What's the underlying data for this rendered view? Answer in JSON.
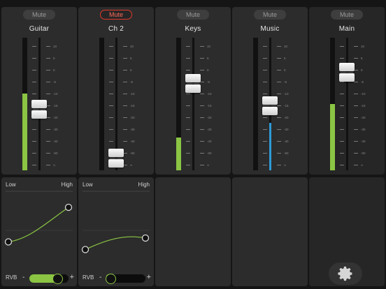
{
  "channels": [
    {
      "name": "Guitar",
      "mute": "Mute",
      "mute_active": false,
      "meter_level": 0.58,
      "fader_pos": 0.45,
      "scale": [
        "10",
        "5",
        "0",
        "-5",
        "-10",
        "-15",
        "-20",
        "-30",
        "-40",
        "-60",
        "∞"
      ]
    },
    {
      "name": "Ch 2",
      "mute": "Mute",
      "mute_active": true,
      "meter_level": 0,
      "fader_pos": 0.02,
      "scale": [
        "10",
        "5",
        "0",
        "-5",
        "-10",
        "-15",
        "-20",
        "-30",
        "-40",
        "-60",
        "∞"
      ]
    },
    {
      "name": "Keys",
      "mute": "Mute",
      "mute_active": false,
      "meter_level": 0.25,
      "fader_pos": 0.68,
      "scale": [
        "10",
        "5",
        "0",
        "-5",
        "-10",
        "-15",
        "-20",
        "-30",
        "-40",
        "-60",
        "∞"
      ]
    },
    {
      "name": "Music",
      "mute": "Mute",
      "mute_active": false,
      "meter_level": 0,
      "fader_pos": 0.48,
      "scale": [
        "10",
        "5",
        "0",
        "-5",
        "-10",
        "-15",
        "-20",
        "-30",
        "-40",
        "-60",
        "∞"
      ],
      "level_bar": 0.36
    },
    {
      "name": "Main",
      "mute": "Mute",
      "mute_active": false,
      "meter_level": 0.5,
      "fader_pos": 0.78,
      "scale": [
        "10",
        "5",
        "0",
        "-5",
        "-10",
        "-15",
        "-20",
        "-30",
        "-40",
        "-60",
        "∞"
      ]
    }
  ],
  "eq": [
    {
      "low": "Low",
      "high": "High",
      "low_gain": -0.15,
      "high_gain": 0.3,
      "rvb_label": "RVB",
      "rvb_minus": "-",
      "rvb_plus": "+",
      "rvb_level": 0.72
    },
    {
      "low": "Low",
      "high": "High",
      "low_gain": -0.25,
      "high_gain": -0.1,
      "rvb_label": "RVB",
      "rvb_minus": "-",
      "rvb_plus": "+",
      "rvb_level": 0.1
    }
  ],
  "settings_icon": "gear-icon",
  "colors": {
    "meter": "#8bc543",
    "mute_active": "#e0392b",
    "level_blue": "#2e9ad6"
  }
}
